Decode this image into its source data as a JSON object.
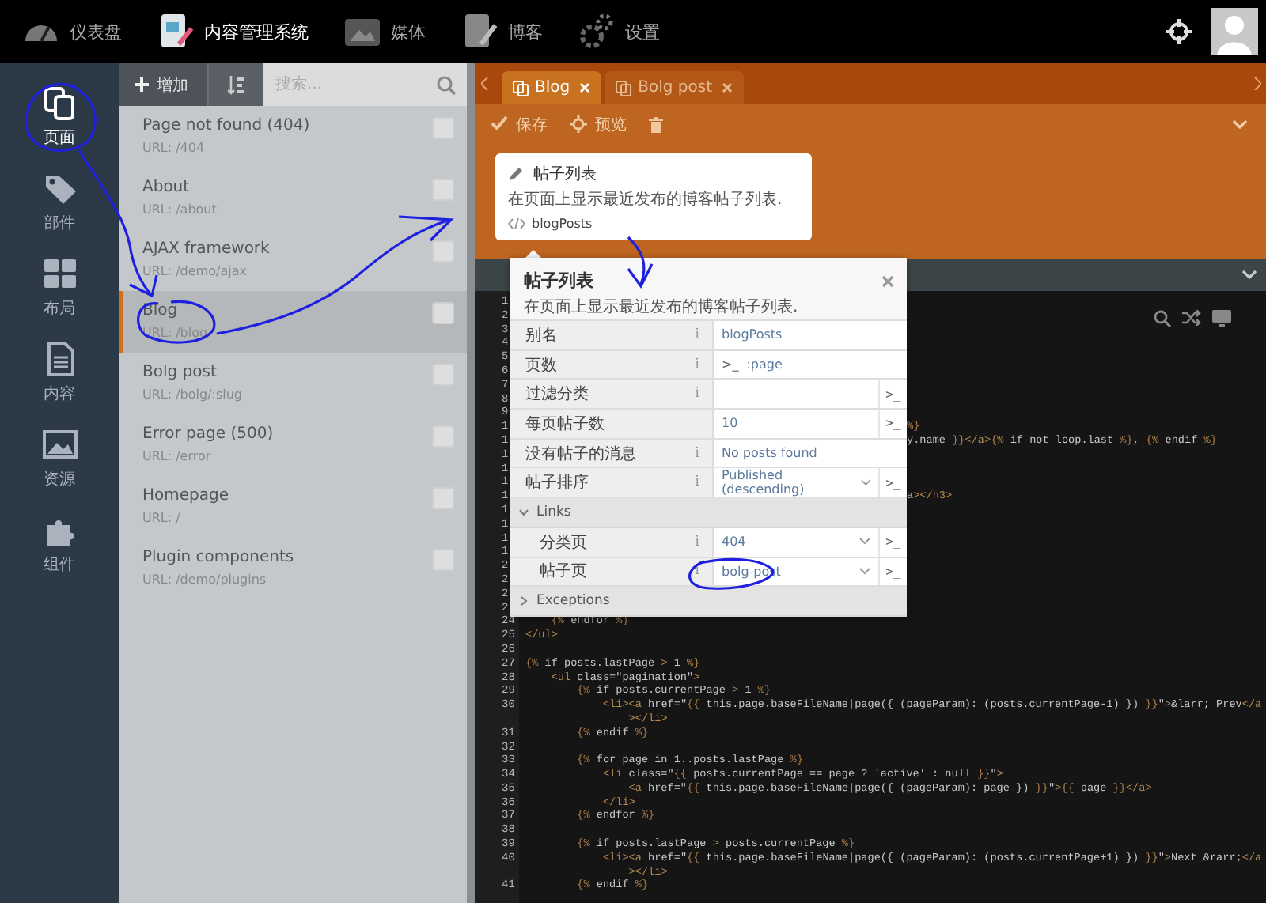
{
  "top_nav": {
    "items": [
      {
        "label": "仪表盘",
        "selected": false
      },
      {
        "label": "内容管理系统",
        "selected": true
      },
      {
        "label": "媒体",
        "selected": false
      },
      {
        "label": "博客",
        "selected": false
      },
      {
        "label": "设置",
        "selected": false
      }
    ]
  },
  "sidebar": {
    "items": [
      {
        "label": "页面",
        "selected": true
      },
      {
        "label": "部件",
        "selected": false
      },
      {
        "label": "布局",
        "selected": false
      },
      {
        "label": "内容",
        "selected": false
      },
      {
        "label": "资源",
        "selected": false
      },
      {
        "label": "组件",
        "selected": false
      }
    ]
  },
  "page_list": {
    "add_button": "增加",
    "search": {
      "placeholder": "搜索..."
    },
    "items": [
      {
        "title": "Page not found (404)",
        "url": "URL: /404",
        "selected": false,
        "checked": false
      },
      {
        "title": "About",
        "url": "URL: /about",
        "selected": false,
        "checked": false
      },
      {
        "title": "AJAX framework",
        "url": "URL: /demo/ajax",
        "selected": false,
        "checked": false
      },
      {
        "title": "Blog",
        "url": "URL: /blog",
        "selected": true,
        "checked": false
      },
      {
        "title": "Bolg post",
        "url": "URL: /bolg/:slug",
        "selected": false,
        "checked": false
      },
      {
        "title": "Error page (500)",
        "url": "URL: /error",
        "selected": false,
        "checked": false
      },
      {
        "title": "Homepage",
        "url": "URL: /",
        "selected": false,
        "checked": false
      },
      {
        "title": "Plugin components",
        "url": "URL: /demo/plugins",
        "selected": false,
        "checked": false
      }
    ]
  },
  "editor": {
    "tabs": [
      {
        "label": "Blog",
        "selected": true
      },
      {
        "label": "Bolg post",
        "selected": false
      }
    ],
    "toolbar": [
      {
        "label": "保存"
      },
      {
        "label": "预览"
      }
    ],
    "component_card": {
      "title": "帖子列表",
      "description": "在页面上显示最近发布的博客帖子列表.",
      "alias": "blogPosts"
    },
    "inspector": {
      "title": "帖子列表",
      "description": "在页面上显示最近发布的博客帖子列表.",
      "rows": [
        {
          "kind": "text",
          "label": "别名",
          "info": "i",
          "value": "blogPosts"
        },
        {
          "kind": "text",
          "label": "页数",
          "info": "i",
          "prefix": ">_",
          "value": ":page"
        },
        {
          "kind": "text",
          "label": "过滤分类",
          "info": "i",
          "expression_button": ">_"
        },
        {
          "kind": "text",
          "label": "每页帖子数",
          "value": "10",
          "expression_button": ">_"
        },
        {
          "kind": "text",
          "label": "没有帖子的消息",
          "info": "i",
          "value": "No posts found"
        },
        {
          "kind": "dropdown",
          "label": "帖子排序",
          "info": "i",
          "value": "Published (descending)",
          "expression_button": ">_"
        },
        {
          "kind": "group",
          "label": "Links",
          "expanded": true,
          "children": [
            {
              "kind": "dropdown",
              "label": "分类页",
              "info": "i",
              "value": "404",
              "expression_button": ">_"
            },
            {
              "kind": "dropdown",
              "label": "帖子页",
              "info": "i",
              "value": "bolg-post",
              "expression_button": ">_"
            }
          ]
        },
        {
          "kind": "group",
          "label": "Exceptions",
          "expanded": false
        }
      ]
    },
    "code_lines": [
      {
        "number": "1"
      },
      {
        "number": "2"
      },
      {
        "number": "3"
      },
      {
        "number": "4"
      },
      {
        "number": "5"
      },
      {
        "number": "6"
      },
      {
        "number": "7"
      },
      {
        "number": "8"
      },
      {
        "number": "9"
      },
      {
        "number": "1",
        "tail": "%}"
      },
      {
        "number": "1",
        "tail": "y.name }}</a>{% if not loop.last %}, {% endif %}"
      },
      {
        "number": "1"
      },
      {
        "number": "1"
      },
      {
        "number": "1"
      },
      {
        "number": "1",
        "tail": "a></h3>"
      },
      {
        "number": "1"
      },
      {
        "number": "1"
      },
      {
        "number": "1"
      },
      {
        "number": "1"
      },
      {
        "number": "2"
      },
      {
        "number": "2"
      },
      {
        "number": "2"
      },
      {
        "number": "2"
      },
      {
        "number": "24",
        "text": "    {% endfor %}"
      },
      {
        "number": "25",
        "text": "</ul>"
      },
      {
        "number": "26"
      },
      {
        "number": "27",
        "text": "{% if posts.lastPage > 1 %}"
      },
      {
        "number": "28",
        "text": "    <ul class=\"pagination\">"
      },
      {
        "number": "29",
        "text": "        {% if posts.currentPage > 1 %}"
      },
      {
        "number": "30",
        "text": "            <li><a href=\"{{ this.page.baseFileName|page({ (pageParam): (posts.currentPage-1) }) }}\">&larr; Prev</a",
        "wrap": "                ></li>"
      },
      {
        "number": "31",
        "text": "        {% endif %}"
      },
      {
        "number": "32"
      },
      {
        "number": "33",
        "text": "        {% for page in 1..posts.lastPage %}"
      },
      {
        "number": "34",
        "text": "            <li class=\"{{ posts.currentPage == page ? 'active' : null }}\">"
      },
      {
        "number": "35",
        "text": "                <a href=\"{{ this.page.baseFileName|page({ (pageParam): page }) }}\">{{ page }}</a>"
      },
      {
        "number": "36",
        "text": "            </li>"
      },
      {
        "number": "37",
        "text": "        {% endfor %}"
      },
      {
        "number": "38"
      },
      {
        "number": "39",
        "text": "        {% if posts.lastPage > posts.currentPage %}"
      },
      {
        "number": "40",
        "text": "            <li><a href=\"{{ this.page.baseFileName|page({ (pageParam): (posts.currentPage+1) }) }}\">Next &rarr;</a",
        "wrap": "                ></li>"
      },
      {
        "number": "41",
        "text": "        {% endif %}"
      }
    ]
  },
  "pen_marks": [
    {
      "kind": "circle"
    },
    {
      "kind": "arrow"
    },
    {
      "kind": "circle"
    },
    {
      "kind": "arrow"
    },
    {
      "kind": "arrow"
    },
    {
      "kind": "circle"
    }
  ]
}
